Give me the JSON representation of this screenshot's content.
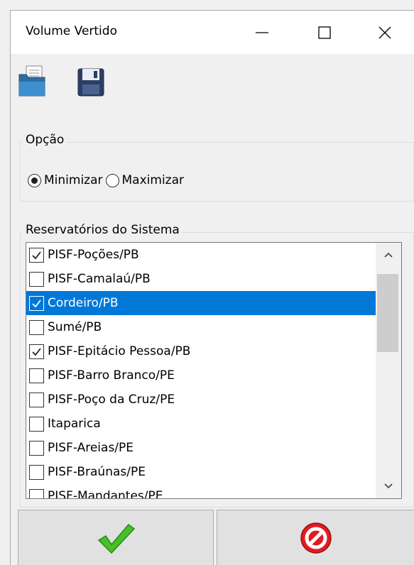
{
  "window": {
    "title": "Volume Vertido",
    "controls": [
      "minimize",
      "maximize",
      "close"
    ]
  },
  "toolbar": {
    "icons": [
      "open-folder-icon",
      "save-disk-icon"
    ]
  },
  "option_group": {
    "label": "Opção",
    "options": [
      {
        "label": "Minimizar",
        "selected": true
      },
      {
        "label": "Maximizar",
        "selected": false
      }
    ]
  },
  "reservoirs_group": {
    "label": "Reservatórios do Sistema",
    "items": [
      {
        "label": "PISF-Poções/PB",
        "checked": true,
        "selected": false
      },
      {
        "label": "PISF-Camalaú/PB",
        "checked": false,
        "selected": false
      },
      {
        "label": "Cordeiro/PB",
        "checked": true,
        "selected": true
      },
      {
        "label": "Sumé/PB",
        "checked": false,
        "selected": false
      },
      {
        "label": "PISF-Epitácio Pessoa/PB",
        "checked": true,
        "selected": false
      },
      {
        "label": "PISF-Barro Branco/PE",
        "checked": false,
        "selected": false
      },
      {
        "label": "PISF-Poço da Cruz/PE",
        "checked": false,
        "selected": false
      },
      {
        "label": "Itaparica",
        "checked": false,
        "selected": false
      },
      {
        "label": "PISF-Areias/PE",
        "checked": false,
        "selected": false
      },
      {
        "label": "PISF-Braúnas/PE",
        "checked": false,
        "selected": false
      },
      {
        "label": "PISF-Mandantes/PE",
        "checked": false,
        "selected": false
      }
    ]
  },
  "buttons": {
    "ok_icon": "green-checkmark-icon",
    "cancel_icon": "red-cancel-icon"
  },
  "colors": {
    "selection": "#0078d7",
    "ok_green": "#3cb521",
    "cancel_red": "#e01b22"
  }
}
